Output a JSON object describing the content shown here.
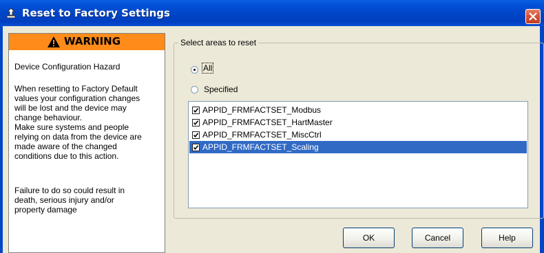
{
  "window": {
    "title": "Reset to Factory Settings",
    "close_icon": "close-icon",
    "title_icon": "tool-icon"
  },
  "warning": {
    "title": "WARNING",
    "icon": "warning-triangle-icon",
    "header_color": "#ff8c1a",
    "heading": "Device Configuration Hazard",
    "body_lines": [
      "When resetting to Factory Default",
      "values your configuration changes",
      "will be lost and the device may",
      "change behaviour.",
      "Make sure systems and people",
      "relying on data from the device are",
      "made aware of the changed",
      "conditions due to this action."
    ],
    "footer_lines": [
      "Failure to do so could result in",
      "death, serious injury and/or",
      "property damage"
    ]
  },
  "reset_group": {
    "label": "Select areas to reset",
    "options": {
      "all": "All",
      "specified": "Specified",
      "selected": "All"
    },
    "items": [
      {
        "label": "APPID_FRMFACTSET_Modbus",
        "checked": true,
        "selected": false
      },
      {
        "label": "APPID_FRMFACTSET_HartMaster",
        "checked": true,
        "selected": false
      },
      {
        "label": "APPID_FRMFACTSET_MiscCtrl",
        "checked": true,
        "selected": false
      },
      {
        "label": "APPID_FRMFACTSET_Scaling",
        "checked": true,
        "selected": true
      }
    ],
    "selection_color": "#316ac5"
  },
  "buttons": {
    "ok": "OK",
    "cancel": "Cancel",
    "help": "Help"
  }
}
